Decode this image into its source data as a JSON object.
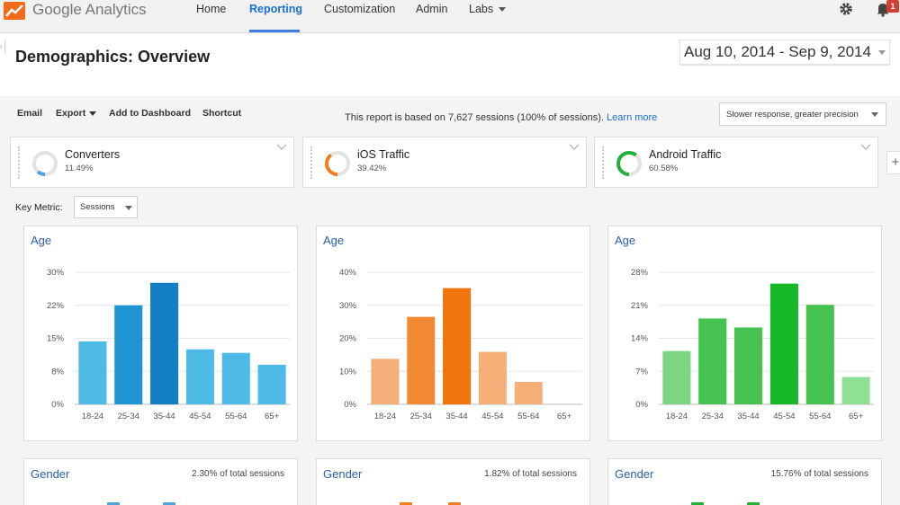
{
  "app": {
    "brand": "Google Analytics",
    "nav": [
      {
        "label": "Home"
      },
      {
        "label": "Reporting"
      },
      {
        "label": "Customization"
      },
      {
        "label": "Admin"
      },
      {
        "label": "Labs"
      }
    ],
    "notification_count": "1"
  },
  "header": {
    "title": "Demographics: Overview",
    "date_range": "Aug 10, 2014 - Sep 9, 2014"
  },
  "toolbar": {
    "email": "Email",
    "export": "Export",
    "add_to_dashboard": "Add to Dashboard",
    "shortcut": "Shortcut",
    "report_note": "This report is based on 7,627 sessions (100% of sessions).",
    "learn_more": "Learn more",
    "precision": "Slower response, greater precision"
  },
  "segments": [
    {
      "name": "Converters",
      "pct": "11.49%",
      "fraction": 0.1149,
      "color": "#4fa3dc"
    },
    {
      "name": "iOS Traffic",
      "pct": "39.42%",
      "fraction": 0.3942,
      "color": "#f07e1f"
    },
    {
      "name": "Android Traffic",
      "pct": "60.58%",
      "fraction": 0.6058,
      "color": "#21b136"
    }
  ],
  "key_metric": {
    "label": "Key Metric:",
    "selected": "Sessions"
  },
  "chart_data": [
    {
      "type": "bar",
      "title": "Age",
      "categories": [
        "18-24",
        "25-34",
        "35-44",
        "45-54",
        "55-64",
        "65+"
      ],
      "values": [
        14.3,
        22.5,
        27.6,
        12.5,
        11.7,
        9.0
      ],
      "yticks": [
        "30%",
        "22%",
        "15%",
        "8%",
        "0%"
      ],
      "ylim": [
        0,
        30
      ],
      "colors": [
        "#4dbbe6",
        "#1e95d2",
        "#137fc2",
        "#4dbbe6",
        "#4dbbe6",
        "#4dbbe6"
      ]
    },
    {
      "type": "bar",
      "title": "Age",
      "categories": [
        "18-24",
        "25-34",
        "35-44",
        "45-54",
        "55-64",
        "65+"
      ],
      "values": [
        13.8,
        26.5,
        35.2,
        15.9,
        6.8,
        0
      ],
      "yticks": [
        "40%",
        "30%",
        "20%",
        "10%",
        "0%"
      ],
      "ylim": [
        0,
        40
      ],
      "colors": [
        "#f5b07a",
        "#f28a33",
        "#f2740d",
        "#f5b07a",
        "#f5b07a",
        "#f5b07a"
      ]
    },
    {
      "type": "bar",
      "title": "Age",
      "categories": [
        "18-24",
        "25-34",
        "35-44",
        "45-54",
        "55-64",
        "65+"
      ],
      "values": [
        11.3,
        18.2,
        16.3,
        25.6,
        21.1,
        5.8
      ],
      "yticks": [
        "28%",
        "21%",
        "14%",
        "7%",
        "0%"
      ],
      "ylim": [
        0,
        28
      ],
      "colors": [
        "#7dd483",
        "#45c24f",
        "#45c24f",
        "#17b828",
        "#45c24f",
        "#8fe095"
      ]
    }
  ],
  "gender": [
    {
      "title": "Gender",
      "note": "2.30% of total sessions",
      "color": "#4fa3dc"
    },
    {
      "title": "Gender",
      "note": "1.82% of total sessions",
      "color": "#f07e1f"
    },
    {
      "title": "Gender",
      "note": "15.76% of total sessions",
      "color": "#21b136"
    }
  ]
}
